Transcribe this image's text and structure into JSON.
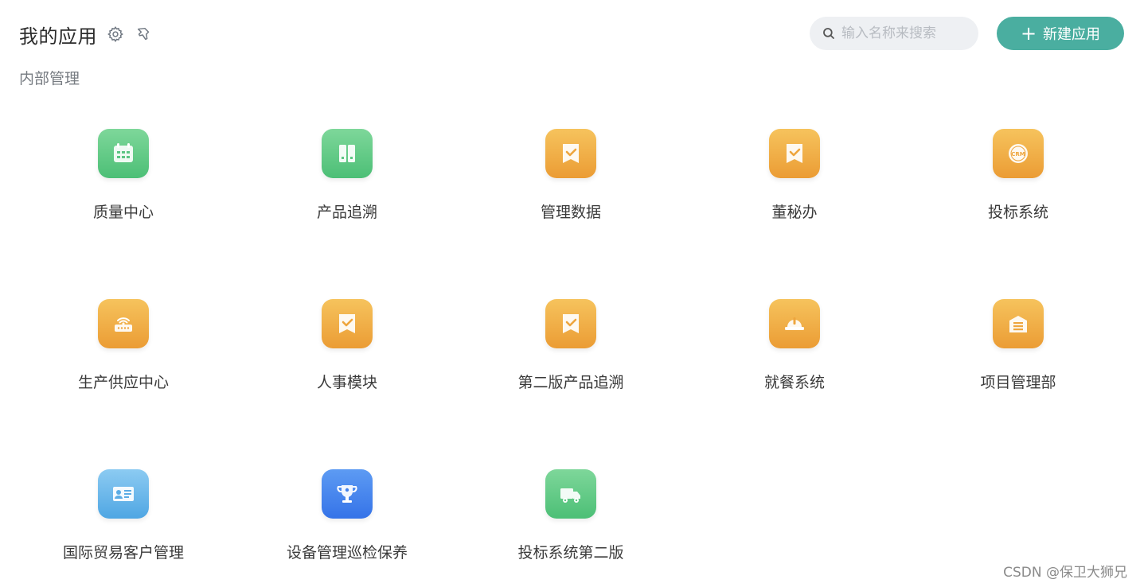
{
  "header": {
    "title": "我的应用",
    "settings_icon": "gear-icon",
    "pin_icon": "pin-icon"
  },
  "search": {
    "icon": "search-icon",
    "placeholder": "输入名称来搜索",
    "value": ""
  },
  "new_app_button": {
    "plus": "+",
    "label": "新建应用",
    "color": "#4aaea0"
  },
  "section": {
    "label": "内部管理"
  },
  "apps": [
    {
      "label": "质量中心",
      "icon": "calendar-icon",
      "color": "green"
    },
    {
      "label": "产品追溯",
      "icon": "barcode-icon",
      "color": "green"
    },
    {
      "label": "管理数据",
      "icon": "check-ribbon-icon",
      "color": "orange"
    },
    {
      "label": "董秘办",
      "icon": "check-ribbon-icon",
      "color": "orange"
    },
    {
      "label": "投标系统",
      "icon": "crm-badge-icon",
      "badge_text": "CRM",
      "color": "orange"
    },
    {
      "label": "生产供应中心",
      "icon": "router-icon",
      "color": "orange"
    },
    {
      "label": "人事模块",
      "icon": "check-ribbon-icon",
      "color": "orange"
    },
    {
      "label": "第二版产品追溯",
      "icon": "check-ribbon-icon",
      "color": "orange"
    },
    {
      "label": "就餐系统",
      "icon": "hardhat-icon",
      "color": "orange"
    },
    {
      "label": "项目管理部",
      "icon": "warehouse-icon",
      "color": "orange"
    },
    {
      "label": "国际贸易客户管理",
      "icon": "id-card-icon",
      "color": "blue"
    },
    {
      "label": "设备管理巡检保养",
      "icon": "trophy-icon",
      "color": "royal"
    },
    {
      "label": "投标系统第二版",
      "icon": "truck-icon",
      "color": "green"
    }
  ],
  "watermark": "CSDN @保卫大狮兄"
}
